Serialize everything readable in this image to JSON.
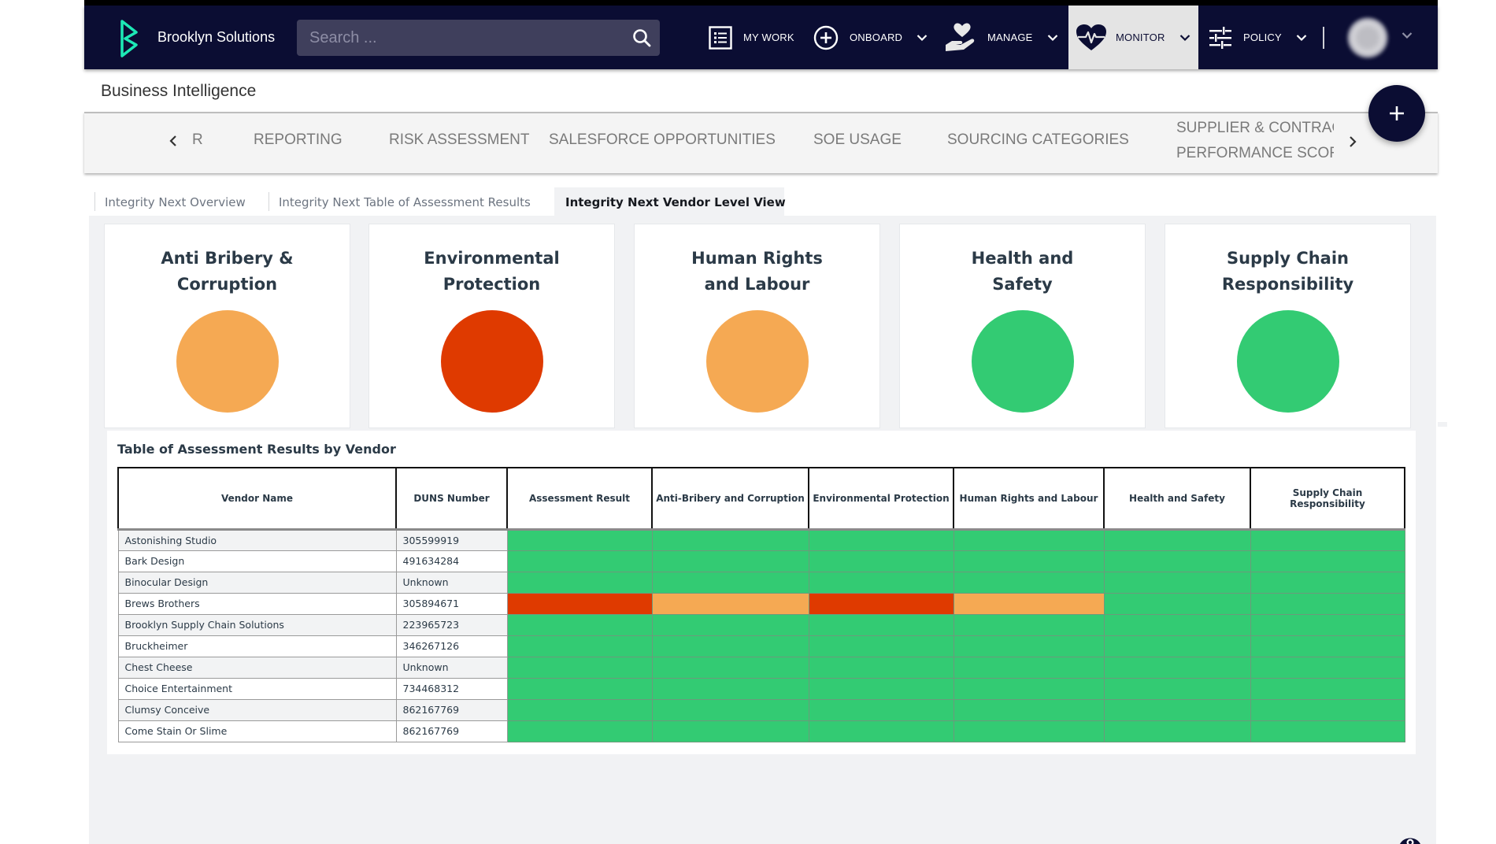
{
  "colors": {
    "header_bg": "#0b0d33",
    "logo_accent": "#1de9b6",
    "status_green": "#33cb73",
    "status_orange": "#f5a953",
    "status_red": "#df3a00"
  },
  "header": {
    "brand": "Brooklyn Solutions",
    "search_placeholder": "Search ...",
    "nav": [
      {
        "label": "MY WORK",
        "icon": "list-icon",
        "has_dropdown": false,
        "active": false
      },
      {
        "label": "ONBOARD",
        "icon": "plus-circle-icon",
        "has_dropdown": true,
        "active": false
      },
      {
        "label": "MANAGE",
        "icon": "heart-hand-icon",
        "has_dropdown": true,
        "active": false
      },
      {
        "label": "MONITOR",
        "icon": "heartbeat-icon",
        "has_dropdown": true,
        "active": true
      },
      {
        "label": "POLICY",
        "icon": "sliders-icon",
        "has_dropdown": true,
        "active": false
      }
    ]
  },
  "page": {
    "title": "Business Intelligence",
    "fab_label": "+"
  },
  "subnav": {
    "prev_label": "‹",
    "next_label": "›",
    "items": [
      {
        "label": "R"
      },
      {
        "label": "REPORTING"
      },
      {
        "label": "RISK ASSESSMENT"
      },
      {
        "label": "SALESFORCE OPPORTUNITIES"
      },
      {
        "label": "SOE USAGE"
      },
      {
        "label": "SOURCING CATEGORIES"
      },
      {
        "label": "SUPPLIER & CONTRACT PERFORMANCE SCORECARD",
        "line1": "SUPPLIER & CONTRAC",
        "line2": "PERFORMANCE SCOR"
      }
    ]
  },
  "tabs": [
    {
      "label": "Integrity Next Overview",
      "active": false
    },
    {
      "label": "Integrity Next Table of Assessment Results",
      "active": false
    },
    {
      "label": "Integrity Next Vendor Level View",
      "active": true
    }
  ],
  "cards": [
    {
      "title": "Anti Bribery & Corruption",
      "status": "orange"
    },
    {
      "title": "Environmental Protection",
      "status": "red"
    },
    {
      "title": "Human Rights and Labour",
      "status": "orange"
    },
    {
      "title": "Health and Safety",
      "status": "green"
    },
    {
      "title": "Supply Chain Responsibility",
      "status": "green"
    }
  ],
  "table": {
    "title": "Table of Assessment Results by Vendor",
    "columns": [
      "Vendor Name",
      "DUNS Number",
      "Assessment Result",
      "Anti-Bribery and Corruption",
      "Environmental Protection",
      "Human Rights and Labour",
      "Health and Safety",
      "Supply Chain Responsibility"
    ],
    "rows": [
      {
        "vendor": "Astonishing Studio",
        "duns": "305599919",
        "statuses": [
          "green",
          "green",
          "green",
          "green",
          "green",
          "green"
        ]
      },
      {
        "vendor": "Bark Design",
        "duns": "491634284",
        "statuses": [
          "green",
          "green",
          "green",
          "green",
          "green",
          "green"
        ]
      },
      {
        "vendor": "Binocular Design",
        "duns": "Unknown",
        "statuses": [
          "green",
          "green",
          "green",
          "green",
          "green",
          "green"
        ]
      },
      {
        "vendor": "Brews Brothers",
        "duns": "305894671",
        "statuses": [
          "red",
          "orange",
          "red",
          "orange",
          "green",
          "green"
        ]
      },
      {
        "vendor": "Brooklyn Supply Chain Solutions",
        "duns": "223965723",
        "statuses": [
          "green",
          "green",
          "green",
          "green",
          "green",
          "green"
        ]
      },
      {
        "vendor": "Bruckheimer",
        "duns": "346267126",
        "statuses": [
          "green",
          "green",
          "green",
          "green",
          "green",
          "green"
        ]
      },
      {
        "vendor": "Chest Cheese",
        "duns": "Unknown",
        "statuses": [
          "green",
          "green",
          "green",
          "green",
          "green",
          "green"
        ]
      },
      {
        "vendor": "Choice Entertainment",
        "duns": "734468312",
        "statuses": [
          "green",
          "green",
          "green",
          "green",
          "green",
          "green"
        ]
      },
      {
        "vendor": "Clumsy Conceive",
        "duns": "862167769",
        "statuses": [
          "green",
          "green",
          "green",
          "green",
          "green",
          "green"
        ]
      },
      {
        "vendor": "Come Stain Or Slime",
        "duns": "862167769",
        "statuses": [
          "green",
          "green",
          "green",
          "green",
          "green",
          "green"
        ]
      }
    ]
  }
}
